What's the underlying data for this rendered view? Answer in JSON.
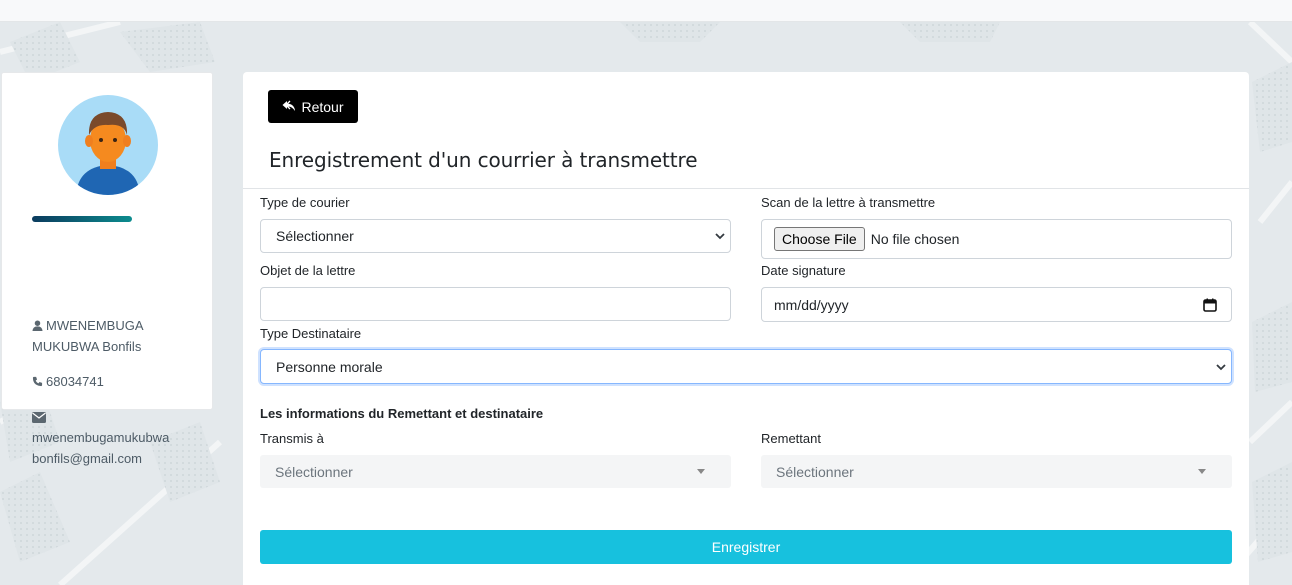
{
  "profile": {
    "name": "MWENEMBUGA MUKUBWA Bonfils",
    "phone": "68034741",
    "email": "mwenembugamukubwa bonfils@gmail.com"
  },
  "main": {
    "back_label": "Retour",
    "title": "Enregistrement d'un courrier à transmettre",
    "fields": {
      "type_courrier_label": "Type de courier",
      "type_courrier_value": "Sélectionner",
      "scan_label": "Scan de la lettre à transmettre",
      "scan_button": "Choose File",
      "scan_status": "No file chosen",
      "objet_label": "Objet de la lettre",
      "objet_value": "",
      "date_label": "Date signature",
      "date_placeholder": "mm/dd/yyyy",
      "type_dest_label": "Type Destinataire",
      "type_dest_value": "Personne morale"
    },
    "section_title": "Les informations du Remettant et destinataire",
    "transmis_label": "Transmis à",
    "transmis_value": "Sélectionner",
    "remettant_label": "Remettant",
    "remettant_value": "Sélectionner",
    "submit_label": "Enregistrer"
  },
  "colors": {
    "submit": "#17c1de",
    "back_button": "#000000",
    "divider_start": "#0b3b5e",
    "divider_end": "#0c8c8e"
  }
}
